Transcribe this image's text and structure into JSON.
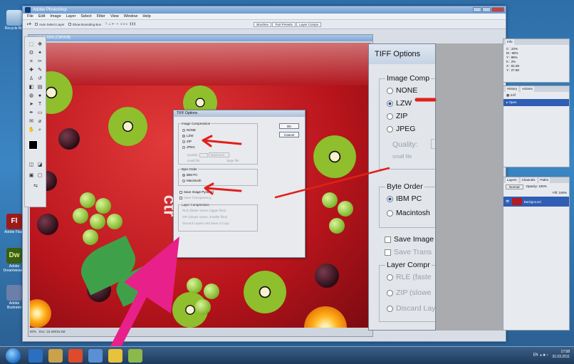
{
  "desktop": {
    "icons": [
      {
        "label": "Recycle Bin"
      },
      {
        "label": "Adobe Flash"
      },
      {
        "label": "Adobe Dreamweaver"
      },
      {
        "label": "Adobe Illustrator"
      }
    ]
  },
  "photoshop": {
    "window_title": "Adobe Photoshop",
    "menu": [
      "File",
      "Edit",
      "Image",
      "Layer",
      "Select",
      "Filter",
      "View",
      "Window",
      "Help"
    ],
    "options": {
      "auto_select": "Auto Select Layer",
      "bounding_box": "Show Bounding Box",
      "palette_tabs": [
        "Brushes",
        "Tool Presets",
        "Layer Comps"
      ]
    },
    "document": {
      "title": "4.tif @ 50% (CMYK/8)",
      "zoom": "50%",
      "doc_size": "Doc: 16.2M/16.2M"
    },
    "watermark_text": "ctr"
  },
  "tiff_dialog_small": {
    "title": "TIFF Options",
    "image_compression_label": "Image Compression",
    "compression_options": [
      "NONE",
      "LZW",
      "ZIP",
      "JPEG"
    ],
    "selected_compression": "LZW",
    "quality_label": "Quality:",
    "quality_value": "Maximum",
    "small_file": "small file",
    "large_file": "large file",
    "byte_order_label": "Byte Order",
    "byte_order_options": [
      "IBM PC",
      "Macintosh"
    ],
    "selected_byte_order": "IBM PC",
    "save_pyramid": "Save Image Pyramid",
    "save_transparency": "Save Transparency",
    "layer_compression_label": "Layer Compression",
    "layer_options": [
      "RLE (faster saves, bigger files)",
      "ZIP (slower saves, smaller files)",
      "Discard Layers and Save a Copy"
    ],
    "ok": "OK",
    "cancel": "Cancel"
  },
  "tiff_dialog_zoom": {
    "title": "TIFF Options",
    "image_compression_label": "Image Comp",
    "compression_options": [
      "NONE",
      "LZW",
      "ZIP",
      "JPEG"
    ],
    "quality_label": "Quality:",
    "small_file": "small file",
    "byte_order_label": "Byte Order",
    "byte_order_options": [
      "IBM PC",
      "Macintosh"
    ],
    "save_image": "Save Image",
    "save_trans": "Save Trans",
    "layer_comp_label": "Layer Compr",
    "layer_options": [
      "RLE (faste",
      "ZIP (slowe",
      "Discard Lay"
    ]
  },
  "palettes": {
    "info_tabs": [
      "Info"
    ],
    "info_values": [
      "C :",
      "M :",
      "Y :",
      "K :",
      "X :",
      "Y :"
    ],
    "history_tabs": [
      "History",
      "Actions"
    ],
    "history_items": [
      "4.tif",
      "Open"
    ],
    "layers_tabs": [
      "Layers",
      "Channels",
      "Paths"
    ],
    "layers_blend": "Normal",
    "layers_opacity": "Opacity: 100%",
    "layers_fill": "Fill: 100%",
    "layer_name": "Background"
  },
  "taskbar": {
    "lang": "EN",
    "time": "17:58",
    "date": "31.03.2011"
  },
  "colors": {
    "annotation_red": "#e0201a",
    "annotation_pink": "#e8208a",
    "canvas_red": "#c41a22"
  }
}
